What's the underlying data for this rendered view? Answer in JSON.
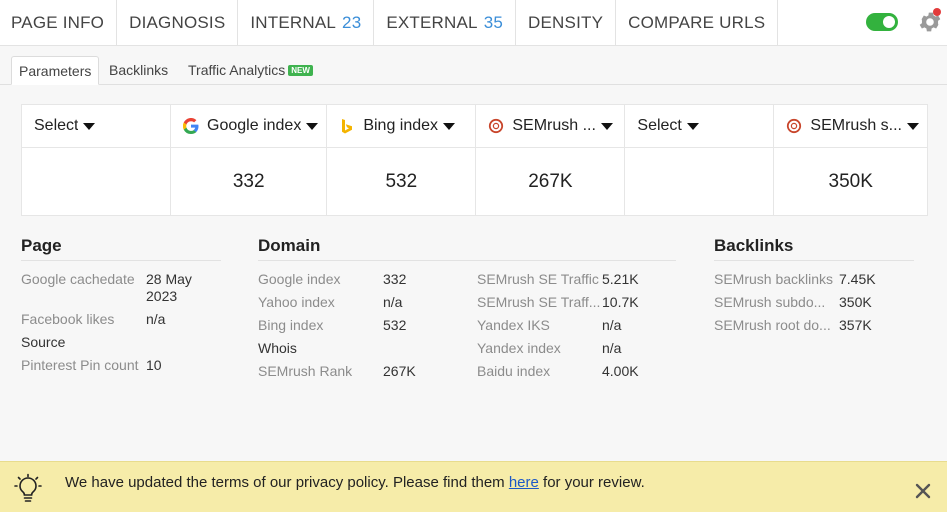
{
  "topbar": {
    "tabs": [
      {
        "label": "PAGE INFO",
        "count": ""
      },
      {
        "label": "DIAGNOSIS",
        "count": ""
      },
      {
        "label": "INTERNAL",
        "count": "23"
      },
      {
        "label": "EXTERNAL",
        "count": "35"
      },
      {
        "label": "DENSITY",
        "count": ""
      },
      {
        "label": "COMPARE URLS",
        "count": ""
      }
    ],
    "toggle_color": "#33b23e",
    "notification_color": "#e23b3b"
  },
  "subtabs": {
    "parameters": "Parameters",
    "backlinks": "Backlinks",
    "traffic": "Traffic Analytics",
    "new_badge": "NEW"
  },
  "grid": {
    "columns": [
      {
        "header": "Select",
        "value": "",
        "icon": "none"
      },
      {
        "header": "Google index",
        "value": "332",
        "icon": "google-icon"
      },
      {
        "header": "Bing index",
        "value": "532",
        "icon": "bing-icon"
      },
      {
        "header": "SEMrush ...",
        "value": "267K",
        "icon": "semrush-icon"
      },
      {
        "header": "Select",
        "value": "",
        "icon": "none"
      },
      {
        "header": "SEMrush s...",
        "value": "350K",
        "icon": "semrush-icon"
      }
    ]
  },
  "page": {
    "title": "Page",
    "rows": [
      {
        "key": "Google cachedate",
        "value": "28 May 2023"
      },
      {
        "key": "Facebook likes",
        "value": "n/a"
      },
      {
        "key": "Source",
        "value": ""
      },
      {
        "key": "Pinterest Pin count",
        "value": "10"
      }
    ]
  },
  "domain": {
    "title": "Domain",
    "left_rows": [
      {
        "key": "Google index",
        "value": "332"
      },
      {
        "key": "Yahoo index",
        "value": "n/a"
      },
      {
        "key": "Bing index",
        "value": "532"
      },
      {
        "key": "Whois",
        "value": ""
      },
      {
        "key": "SEMrush Rank",
        "value": "267K"
      }
    ],
    "right_rows": [
      {
        "key": "SEMrush SE Traffic",
        "value": "5.21K"
      },
      {
        "key": "SEMrush SE Traff...",
        "value": "10.7K"
      },
      {
        "key": "Yandex IKS",
        "value": "n/a"
      },
      {
        "key": "Yandex index",
        "value": "n/a"
      },
      {
        "key": "Baidu index",
        "value": "4.00K"
      }
    ]
  },
  "backlinks": {
    "title": "Backlinks",
    "rows": [
      {
        "key": "SEMrush backlinks",
        "value": "7.45K"
      },
      {
        "key": "SEMrush subdo...",
        "value": "350K"
      },
      {
        "key": "SEMrush root do...",
        "value": "357K"
      }
    ]
  },
  "banner": {
    "text_before": "We have updated the terms of our privacy policy. Please find them ",
    "link_text": "here",
    "text_after": " for your review.",
    "background": "#f6eca9"
  }
}
